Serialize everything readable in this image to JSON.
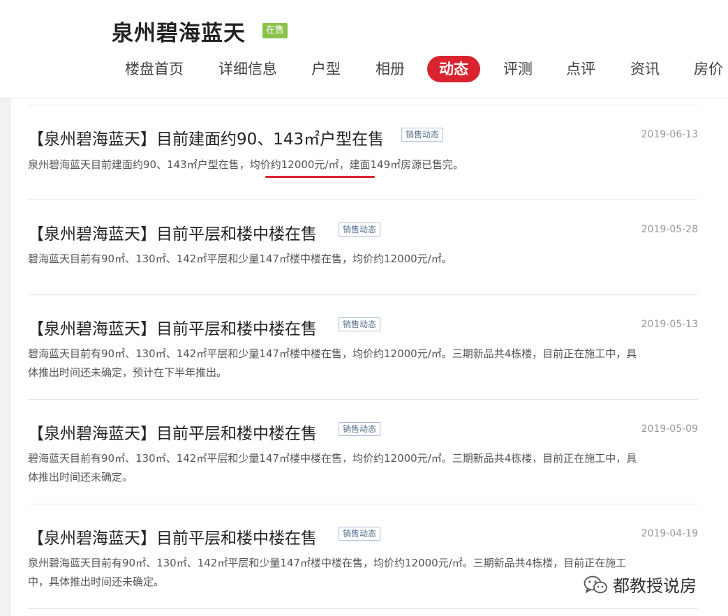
{
  "header": {
    "title": "泉州碧海蓝天",
    "status_badge": "在售",
    "nav": [
      {
        "label": "楼盘首页"
      },
      {
        "label": "详细信息"
      },
      {
        "label": "户型"
      },
      {
        "label": "相册"
      },
      {
        "label": "动态"
      },
      {
        "label": "评测"
      },
      {
        "label": "点评"
      },
      {
        "label": "资讯"
      },
      {
        "label": "房价"
      }
    ],
    "active_tab": "动态"
  },
  "posts": [
    {
      "title": "【泉州碧海蓝天】目前建面约90、143㎡户型在售",
      "tag": "销售动态",
      "date": "2019-06-13",
      "body_before": "泉州碧海蓝天目前建面约90、143㎡户型在售，",
      "body_highlight": "均价约12000元/㎡",
      "body_after": "，建面149㎡房源已售完。"
    },
    {
      "title": "【泉州碧海蓝天】目前平层和楼中楼在售",
      "tag": "销售动态",
      "date": "2019-05-28",
      "body_line1": "碧海蓝天目前有90㎡、130㎡、142㎡平层和少量147㎡楼中楼在售，均价约12000元/㎡。"
    },
    {
      "title": "【泉州碧海蓝天】目前平层和楼中楼在售",
      "tag": "销售动态",
      "date": "2019-05-13",
      "body_line1": "碧海蓝天目前有90㎡、130㎡、142㎡平层和少量147㎡楼中楼在售，均价约12000元/㎡。三期新品共4栋楼，目前正在施工中，具",
      "body_line2": "体推出时间还未确定，预计在下半年推出。"
    },
    {
      "title": "【泉州碧海蓝天】目前平层和楼中楼在售",
      "tag": "销售动态",
      "date": "2019-05-09",
      "body_line1": "碧海蓝天目前有90㎡、130㎡、142㎡平层和少量147㎡楼中楼在售，均价约12000元/㎡。三期新品共4栋楼，目前正在施工中，具",
      "body_line2": "体推出时间还未确定。"
    },
    {
      "title": "【泉州碧海蓝天】目前平层和楼中楼在售",
      "tag": "销售动态",
      "date": "2019-04-19",
      "body_line1": "泉州碧海蓝天目前有90㎡、130㎡、142㎡平层和少量147㎡楼中楼在售，均价约12000元/㎡。三期新品共4栋楼，目前正在施工",
      "body_line2": "中，具体推出时间还未确定。"
    }
  ],
  "watermark": {
    "text": "都教授说房",
    "icon": "wechat-icon"
  },
  "colors": {
    "accent": "#d9232e",
    "badge_green": "#8bc34a",
    "tag_border": "#a9bcd6",
    "date_gray": "#999999"
  }
}
